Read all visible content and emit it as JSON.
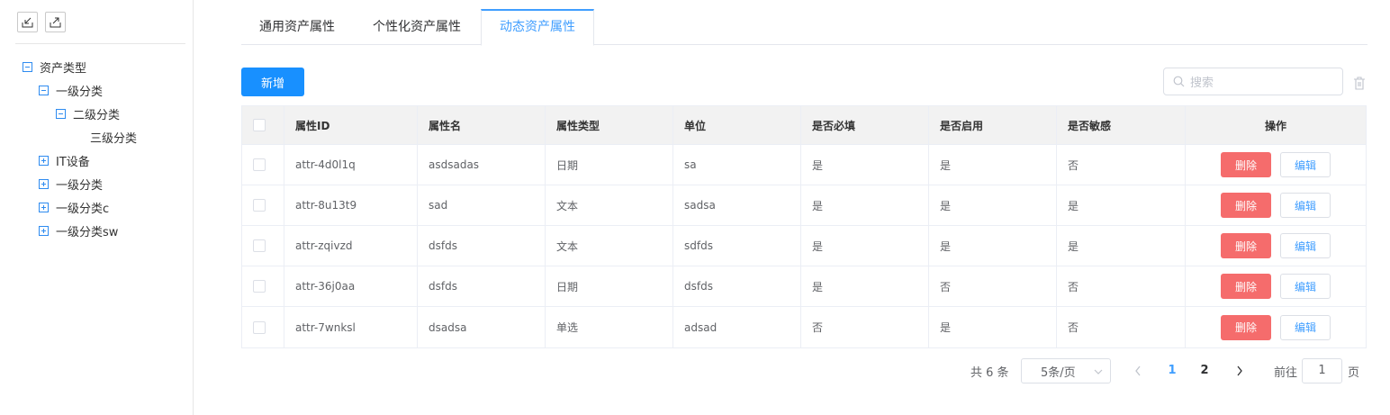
{
  "sidebar": {
    "tools": [
      {
        "icon": "import-icon"
      },
      {
        "icon": "export-icon"
      }
    ],
    "tree": [
      {
        "label": "资产类型",
        "level": 0,
        "state": "expanded"
      },
      {
        "label": "一级分类",
        "level": 1,
        "state": "expanded"
      },
      {
        "label": "二级分类",
        "level": 2,
        "state": "expanded"
      },
      {
        "label": "三级分类",
        "level": 3,
        "state": "leaf"
      },
      {
        "label": "IT设备",
        "level": 1,
        "state": "collapsed"
      },
      {
        "label": "一级分类",
        "level": 1,
        "state": "collapsed"
      },
      {
        "label": "一级分类c",
        "level": 1,
        "state": "collapsed"
      },
      {
        "label": "一级分类sw",
        "level": 1,
        "state": "collapsed"
      }
    ]
  },
  "tabs": [
    {
      "label": "通用资产属性",
      "active": false
    },
    {
      "label": "个性化资产属性",
      "active": false
    },
    {
      "label": "动态资产属性",
      "active": true
    }
  ],
  "toolbar": {
    "add_label": "新增",
    "search_placeholder": "搜索",
    "trash_icon": "trash-icon"
  },
  "table": {
    "headers": [
      "属性ID",
      "属性名",
      "属性类型",
      "单位",
      "是否必填",
      "是否启用",
      "是否敏感",
      "操作"
    ],
    "rows": [
      {
        "id": "attr-4d0l1q",
        "name": "asdsadas",
        "type": "日期",
        "unit": "sa",
        "required": "是",
        "enabled": "是",
        "sensitive": "否"
      },
      {
        "id": "attr-8u13t9",
        "name": "sad",
        "type": "文本",
        "unit": "sadsa",
        "required": "是",
        "enabled": "是",
        "sensitive": "是"
      },
      {
        "id": "attr-zqivzd",
        "name": "dsfds",
        "type": "文本",
        "unit": "sdfds",
        "required": "是",
        "enabled": "是",
        "sensitive": "是"
      },
      {
        "id": "attr-36j0aa",
        "name": "dsfds",
        "type": "日期",
        "unit": "dsfds",
        "required": "是",
        "enabled": "否",
        "sensitive": "否"
      },
      {
        "id": "attr-7wnksl",
        "name": "dsadsa",
        "type": "单选",
        "unit": "adsad",
        "required": "否",
        "enabled": "是",
        "sensitive": "否"
      }
    ],
    "delete_label": "删除",
    "edit_label": "编辑"
  },
  "pagination": {
    "total_text": "共 6 条",
    "page_size": "5条/页",
    "pages": [
      "1",
      "2"
    ],
    "current_page": "1",
    "jump_prefix": "前往",
    "jump_value": "1",
    "jump_suffix": "页"
  },
  "colors": {
    "primary": "#1890ff",
    "active_tab": "#409eff",
    "danger": "#f56c6c",
    "tree_toggle": "#2e8bf0"
  }
}
